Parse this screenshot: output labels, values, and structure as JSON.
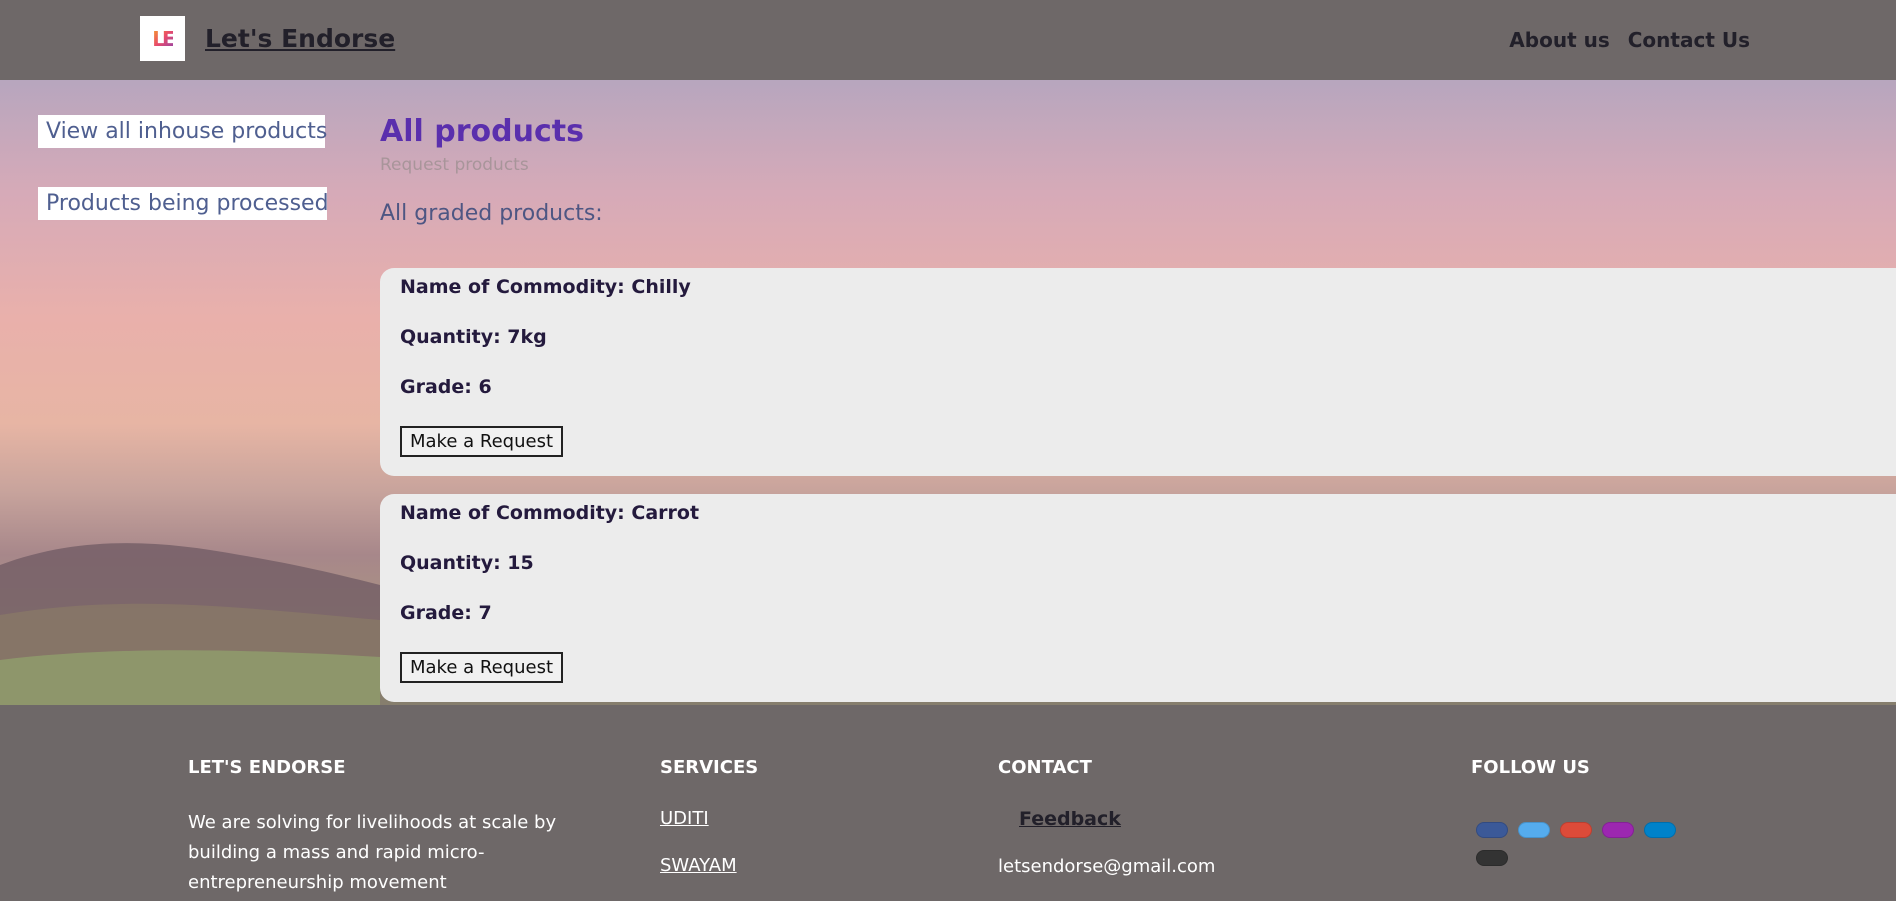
{
  "header": {
    "brand": "Let's Endorse",
    "logo_text": "LE",
    "nav": [
      "About us",
      "Contact Us"
    ]
  },
  "sidebar": {
    "items": [
      "View all inhouse products",
      "Products being processed"
    ]
  },
  "main": {
    "title": "All products",
    "request_link": "Request products",
    "section_heading": "All graded products:",
    "products": [
      {
        "name": "Name of Commodity: Chilly",
        "quantity": "Quantity: 7kg",
        "grade": "Grade: 6",
        "button": "Make a Request"
      },
      {
        "name": "Name of Commodity: Carrot",
        "quantity": "Quantity: 15",
        "grade": "Grade: 7",
        "button": "Make a Request"
      }
    ]
  },
  "footer": {
    "about": {
      "heading": "LET'S ENDORSE",
      "text": "We are solving for livelihoods at scale by building a mass and rapid micro-entrepreneurship movement"
    },
    "services": {
      "heading": "SERVICES",
      "links": [
        "UDITI",
        "SWAYAM"
      ]
    },
    "contact": {
      "heading": "CONTACT",
      "feedback": "Feedback",
      "email": "letsendorse@gmail.com"
    },
    "follow": {
      "heading": "FOLLOW US",
      "icons": [
        {
          "name": "facebook-icon",
          "color": "#3b5998"
        },
        {
          "name": "twitter-icon",
          "color": "#55acee"
        },
        {
          "name": "google-icon",
          "color": "#dd4b39"
        },
        {
          "name": "instagram-icon",
          "color": "#9c27b0"
        },
        {
          "name": "linkedin-icon",
          "color": "#0082ca"
        },
        {
          "name": "github-icon",
          "color": "#333333"
        }
      ]
    }
  },
  "colors": {
    "bar_bg": "#6e6868",
    "title": "#5a2fad",
    "card_bg": "#ececec"
  }
}
